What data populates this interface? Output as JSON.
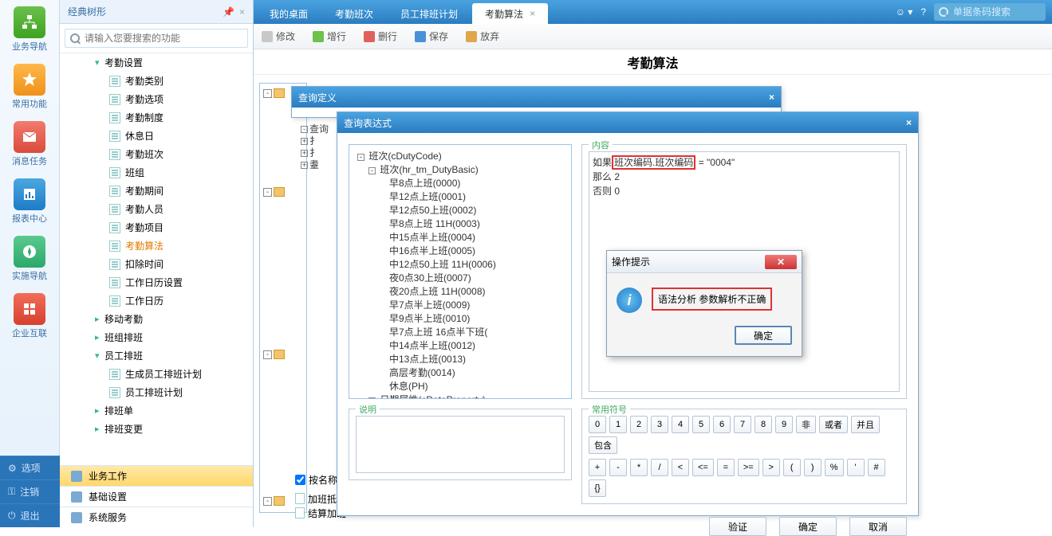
{
  "leftRail": {
    "items": [
      {
        "label": "业务导航"
      },
      {
        "label": "常用功能"
      },
      {
        "label": "消息任务"
      },
      {
        "label": "报表中心"
      },
      {
        "label": "实施导航"
      },
      {
        "label": "企业互联"
      }
    ],
    "bottom": [
      {
        "label": "选项"
      },
      {
        "label": "注销"
      },
      {
        "label": "退出"
      }
    ]
  },
  "treePanel": {
    "title": "经典树形",
    "searchPlaceholder": "请输入您要搜索的功能",
    "nodes": [
      {
        "level": 2,
        "caret": "▾",
        "label": "考勤设置"
      },
      {
        "level": 3,
        "doc": true,
        "label": "考勤类别"
      },
      {
        "level": 3,
        "doc": true,
        "label": "考勤选项"
      },
      {
        "level": 3,
        "doc": true,
        "label": "考勤制度"
      },
      {
        "level": 3,
        "doc": true,
        "label": "休息日"
      },
      {
        "level": 3,
        "doc": true,
        "label": "考勤班次"
      },
      {
        "level": 3,
        "doc": true,
        "label": "班组"
      },
      {
        "level": 3,
        "doc": true,
        "label": "考勤期间"
      },
      {
        "level": 3,
        "doc": true,
        "label": "考勤人员"
      },
      {
        "level": 3,
        "doc": true,
        "label": "考勤项目"
      },
      {
        "level": 3,
        "doc": true,
        "label": "考勤算法",
        "active": true
      },
      {
        "level": 3,
        "doc": true,
        "label": "扣除时间"
      },
      {
        "level": 3,
        "doc": true,
        "label": "工作日历设置"
      },
      {
        "level": 3,
        "doc": true,
        "label": "工作日历"
      },
      {
        "level": 2,
        "caret": "▸",
        "label": "移动考勤"
      },
      {
        "level": 2,
        "caret": "▸",
        "label": "班组排班"
      },
      {
        "level": 2,
        "caret": "▾",
        "label": "员工排班"
      },
      {
        "level": 3,
        "doc": true,
        "label": "生成员工排班计划"
      },
      {
        "level": 3,
        "doc": true,
        "label": "员工排班计划"
      },
      {
        "level": 2,
        "caret": "▸",
        "label": "排班单"
      },
      {
        "level": 2,
        "caret": "▸",
        "label": "排班变更"
      }
    ],
    "bottomTabs": [
      {
        "label": "业务工作",
        "active": true
      },
      {
        "label": "基础设置"
      },
      {
        "label": "系统服务"
      }
    ]
  },
  "mainTabs": [
    {
      "label": "我的桌面"
    },
    {
      "label": "考勤班次"
    },
    {
      "label": "员工排班计划"
    },
    {
      "label": "考勤算法",
      "active": true,
      "closable": true
    }
  ],
  "topSearchPlaceholder": "单据条码搜索",
  "toolbar": [
    {
      "label": "修改",
      "color": "#c8c8c8"
    },
    {
      "label": "增行",
      "color": "#6cc24a"
    },
    {
      "label": "删行",
      "color": "#e0615c"
    },
    {
      "label": "保存",
      "color": "#4a90d9"
    },
    {
      "label": "放弃",
      "color": "#e0a84a"
    }
  ],
  "pageTitle": "考勤算法",
  "win1": {
    "title": "查询定义",
    "items": [
      "查询",
      "扌",
      "扌",
      "耋"
    ]
  },
  "win2": {
    "title": "查询表达式",
    "schema": [
      "班次(cDutyCode)",
      "班次(hr_tm_DutyBasic)",
      "早8点上班(0000)",
      "早12点上班(0001)",
      "早12点50上班(0002)",
      "早8点上班 11H(0003)",
      "中15点半上班(0004)",
      "中16点半上班(0005)",
      "中12点50上班 11H(0006)",
      "夜0点30上班(0007)",
      "夜20点上班 11H(0008)",
      "早7点半上班(0009)",
      "早9点半上班(0010)",
      "早7点上班 16点半下班(",
      "中14点半上班(0012)",
      "中13点上班(0013)",
      "高层考勤(0014)",
      "休息(PH)",
      "日期属性(cDateProperty)"
    ],
    "contentLabel": "内容",
    "expr": {
      "l1a": "如果",
      "l1h": "班次编码.班次编码",
      "l1b": "= \"0004\"",
      "l2": "那么 2",
      "l3": "否则 0"
    },
    "descLabel": "说明",
    "symLabel": "常用符号",
    "symbolsRow1": [
      "0",
      "1",
      "2",
      "3",
      "4",
      "5",
      "6",
      "7",
      "8",
      "9",
      "非",
      "或者",
      "并且",
      "包含"
    ],
    "symbolsRow2": [
      "+",
      "-",
      "*",
      "/",
      "<",
      "<=",
      "=",
      ">=",
      ">",
      "(",
      ")",
      "%",
      "'",
      "#",
      "{}"
    ],
    "buttons": {
      "verify": "验证",
      "ok": "确定",
      "cancel": "取消"
    }
  },
  "miniPanel": {
    "chk": "按名称",
    "rows": [
      "加班抵扣",
      "结算加班"
    ]
  },
  "msgbox": {
    "title": "操作提示",
    "text": "语法分析 参数解析不正确",
    "ok": "确定"
  }
}
